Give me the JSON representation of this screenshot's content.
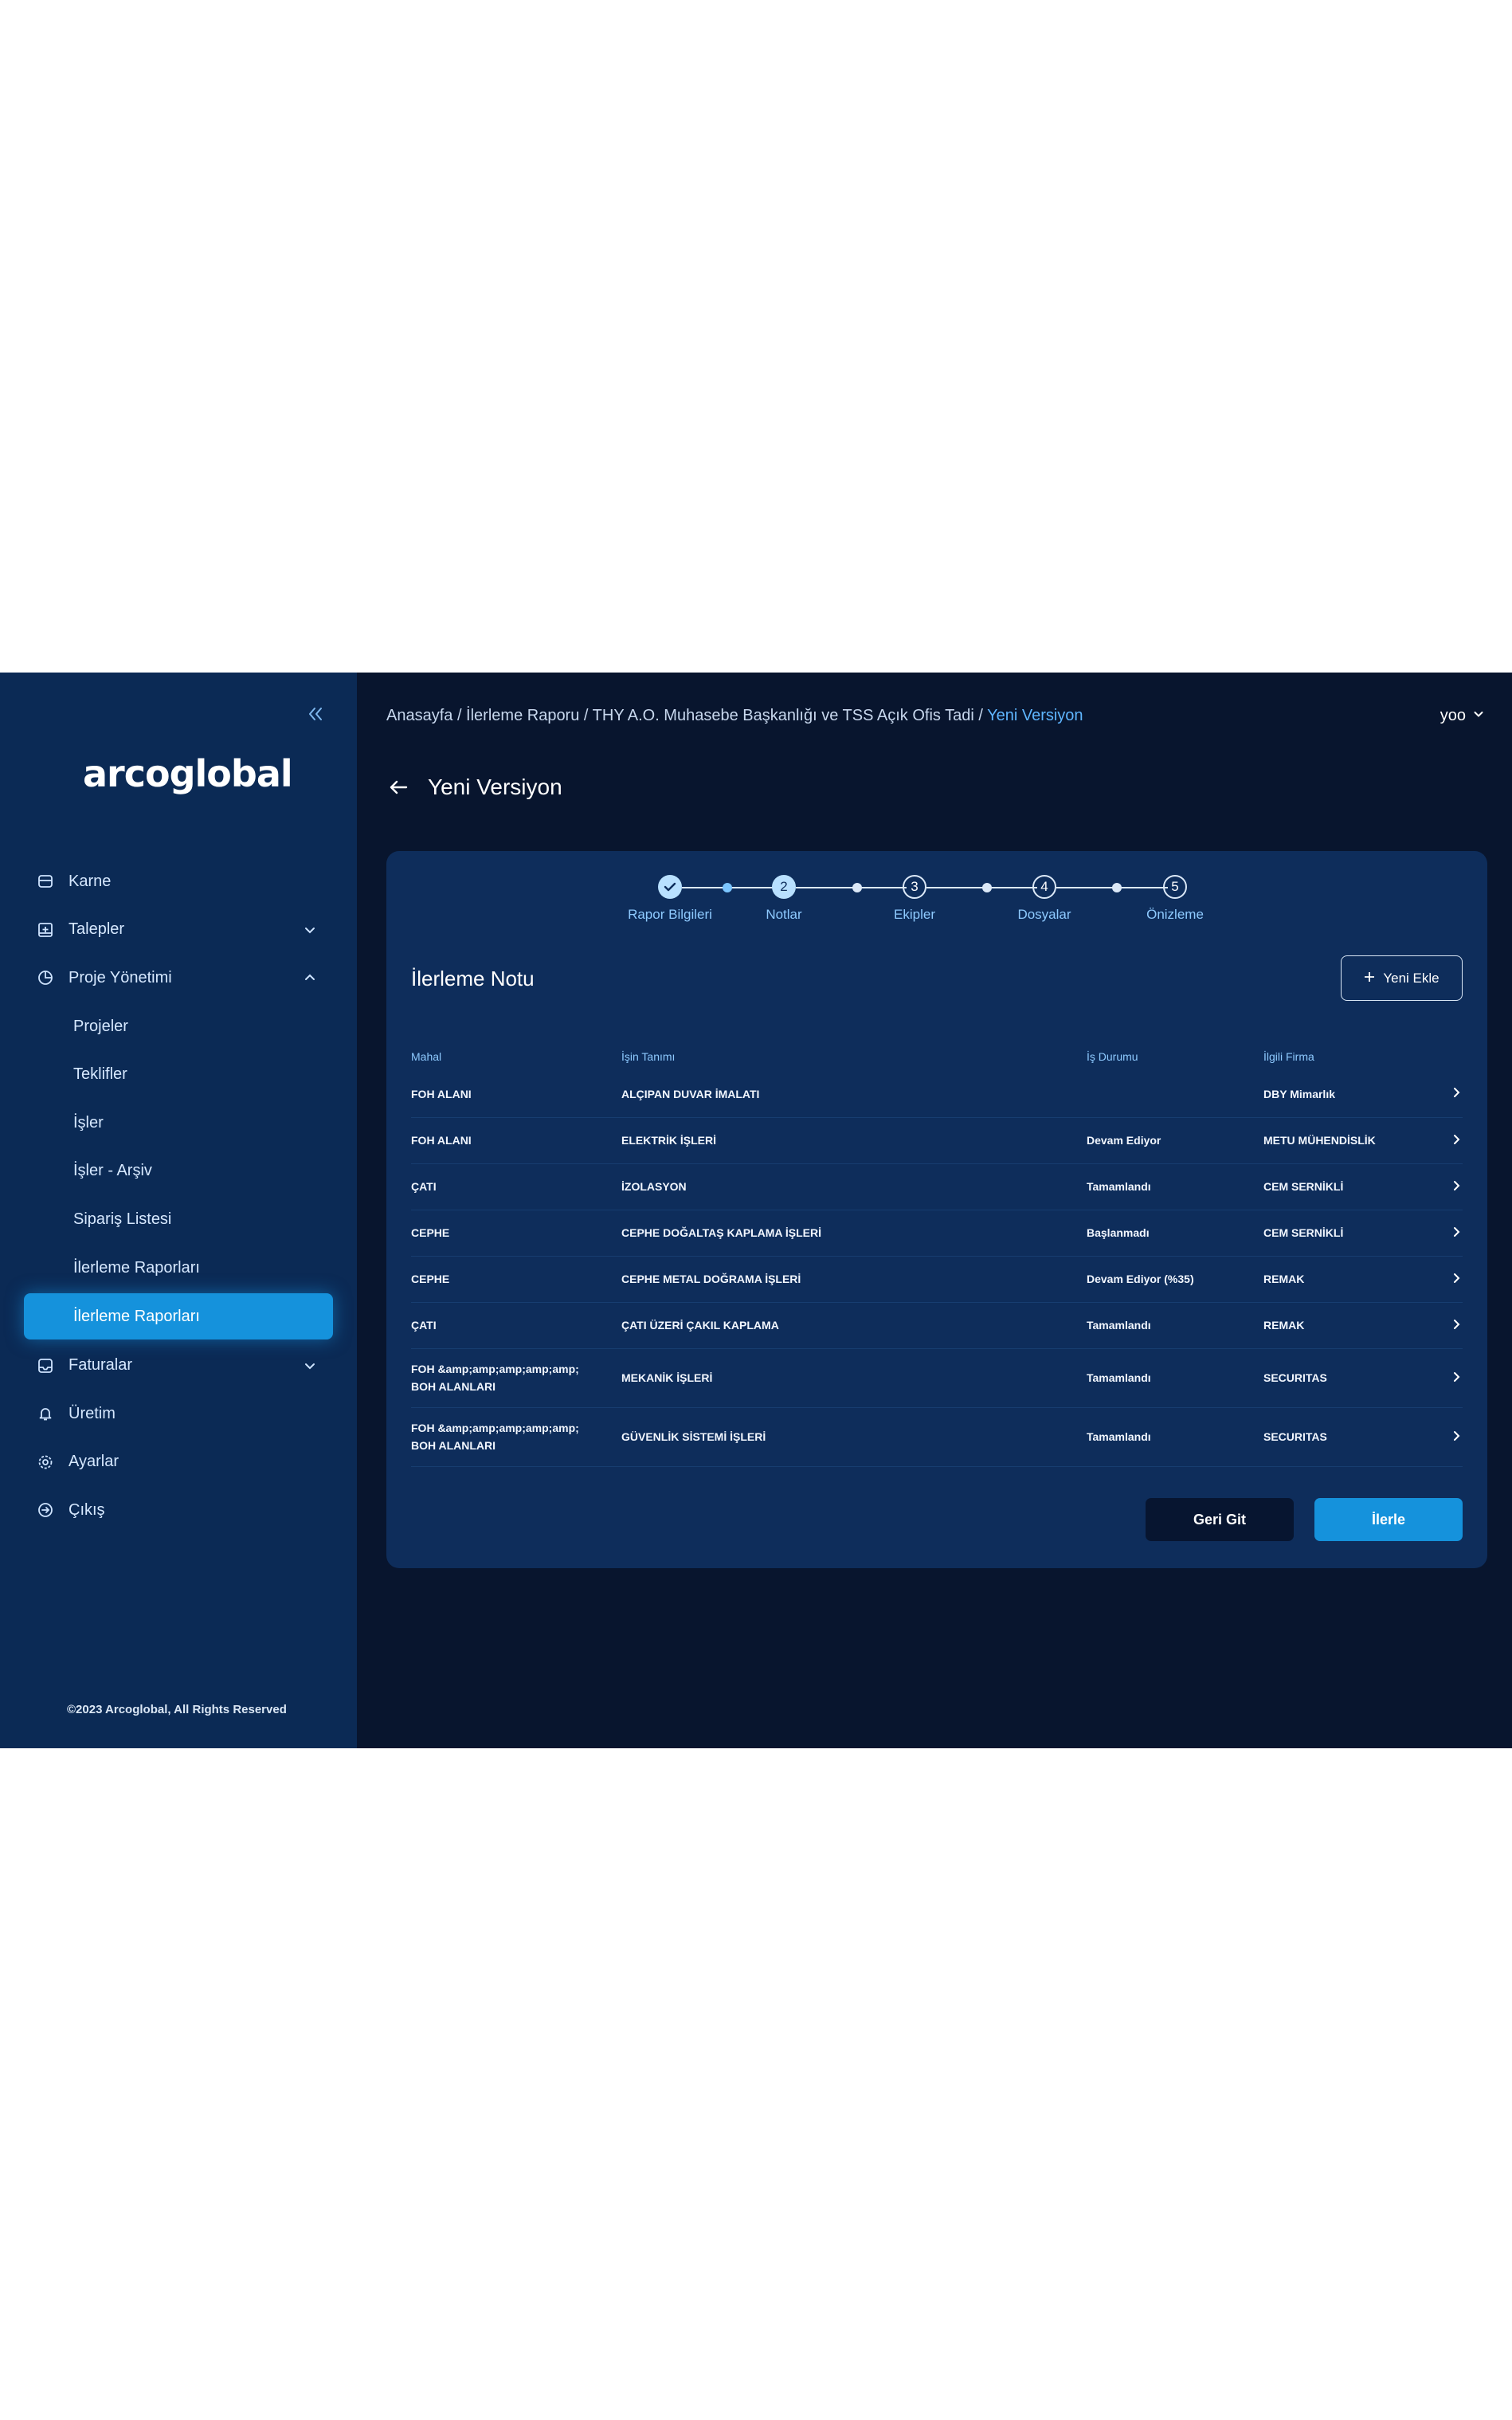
{
  "colors": {
    "sidebar_bg": "#0b2a55",
    "main_bg": "#08152e",
    "card_bg": "#0e2d5b",
    "accent": "#1592dc",
    "label": "#8ecaff"
  },
  "sidebar": {
    "logo": "arcoglobal",
    "items": [
      {
        "label": "Karne",
        "icon": "id-card-icon"
      },
      {
        "label": "Talepler",
        "icon": "inbox-plus-icon"
      },
      {
        "label": "Proje Yönetimi",
        "icon": "pie-chart-icon"
      },
      {
        "label": "Projeler"
      },
      {
        "label": "Teklifler"
      },
      {
        "label": "İşler"
      },
      {
        "label": "İşler - Arşiv"
      },
      {
        "label": "Sipariş Listesi"
      },
      {
        "label": "İlerleme Raporları"
      },
      {
        "label": "İlerleme Raporları"
      },
      {
        "label": "Faturalar",
        "icon": "invoice-icon"
      },
      {
        "label": "Üretim",
        "icon": "bell-icon"
      },
      {
        "label": "Ayarlar",
        "icon": "gear-icon"
      },
      {
        "label": "Çıkış",
        "icon": "logout-icon"
      }
    ],
    "footer": "©2023 Arcoglobal, All Rights Reserved"
  },
  "header": {
    "breadcrumb_path": "Anasayfa / İlerleme Raporu / THY A.O. Muhasebe Başkanlığı ve TSS Açık Ofis Tadi / ",
    "breadcrumb_current": "Yeni Versiyon",
    "user": "yoo"
  },
  "page": {
    "title": "Yeni Versiyon"
  },
  "stepper": {
    "steps": [
      {
        "num": "",
        "label": "Rapor Bilgileri"
      },
      {
        "num": "2",
        "label": "Notlar"
      },
      {
        "num": "3",
        "label": "Ekipler"
      },
      {
        "num": "4",
        "label": "Dosyalar"
      },
      {
        "num": "5",
        "label": "Önizleme"
      }
    ]
  },
  "section": {
    "title": "İlerleme Notu",
    "add_label": "Yeni Ekle"
  },
  "table": {
    "headers": [
      "Mahal",
      "İşin Tanımı",
      "İş Durumu",
      "İlgili Firma"
    ],
    "rows": [
      [
        "FOH ALANI",
        "ALÇIPAN DUVAR İMALATI",
        "",
        "DBY Mimarlık"
      ],
      [
        "FOH ALANI",
        "ELEKTRİK İŞLERİ",
        "Devam Ediyor",
        "METU MÜHENDİSLİK"
      ],
      [
        "ÇATI",
        "İZOLASYON",
        "Tamamlandı",
        "CEM SERNİKLİ"
      ],
      [
        "CEPHE",
        "CEPHE DOĞALTAŞ KAPLAMA İŞLERİ",
        "Başlanmadı",
        "CEM SERNİKLİ"
      ],
      [
        "CEPHE",
        "CEPHE METAL DOĞRAMA İŞLERİ",
        "Devam Ediyor (%35)",
        "REMAK"
      ],
      [
        "ÇATI",
        "ÇATI ÜZERİ ÇAKIL KAPLAMA",
        "Tamamlandı",
        "REMAK"
      ],
      [
        "FOH &amp;amp;amp;amp;amp; BOH ALANLARI",
        "MEKANİK İŞLERİ",
        "Tamamlandı",
        "SECURITAS"
      ],
      [
        "FOH &amp;amp;amp;amp;amp; BOH ALANLARI",
        "GÜVENLİK SİSTEMİ İŞLERİ",
        "Tamamlandı",
        "SECURITAS"
      ]
    ]
  },
  "actions": {
    "back_label": "Geri Git",
    "next_label": "İlerle"
  }
}
